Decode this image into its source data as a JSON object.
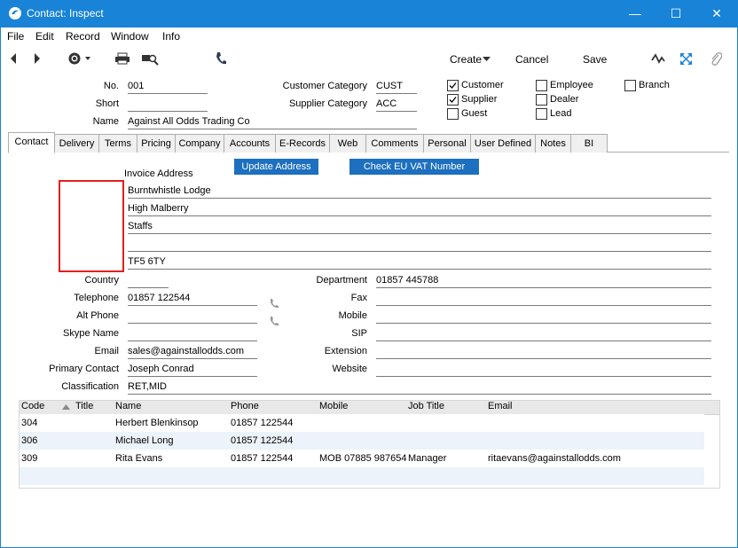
{
  "window": {
    "title": "Contact: Inspect"
  },
  "menus": [
    "File",
    "Edit",
    "Record",
    "Window",
    "Info"
  ],
  "toolbar": {
    "create": "Create",
    "cancel": "Cancel",
    "save": "Save"
  },
  "header": {
    "no_label": "No.",
    "no_value": "001",
    "short_label": "Short",
    "short_value": "",
    "name_label": "Name",
    "name_value": "Against All Odds Trading Co",
    "customer_category_label": "Customer Category",
    "customer_category_value": "CUST",
    "supplier_category_label": "Supplier Category",
    "supplier_category_value": "ACC"
  },
  "checkboxes": [
    {
      "label": "Customer",
      "checked": true
    },
    {
      "label": "Supplier",
      "checked": true
    },
    {
      "label": "Guest",
      "checked": false
    },
    {
      "label": "Employee",
      "checked": false
    },
    {
      "label": "Dealer",
      "checked": false
    },
    {
      "label": "Lead",
      "checked": false
    },
    {
      "label": "Branch",
      "checked": false
    }
  ],
  "tabs": [
    "Contact",
    "Delivery",
    "Terms",
    "Pricing",
    "Company",
    "Accounts",
    "E-Records",
    "Web",
    "Comments",
    "Personal",
    "User Defined",
    "Notes",
    "BI"
  ],
  "buttons": {
    "update_address": "Update Address",
    "check_vat": "Check EU VAT Number"
  },
  "address": {
    "label": "Invoice Address",
    "lines": [
      "Burntwhistle Lodge",
      "High Malberry",
      "Staffs",
      "",
      "TF5 6TY"
    ]
  },
  "fields_left": [
    {
      "label": "Country",
      "value": ""
    },
    {
      "label": "Telephone",
      "value": "01857 122544"
    },
    {
      "label": "Alt Phone",
      "value": ""
    },
    {
      "label": "Skype Name",
      "value": ""
    },
    {
      "label": "Email",
      "value": "sales@againstallodds.com"
    },
    {
      "label": "Primary Contact",
      "value": "Joseph Conrad"
    },
    {
      "label": "Classification",
      "value": "RET,MID"
    }
  ],
  "fields_right": [
    {
      "label": "Department",
      "value": "01857 445788"
    },
    {
      "label": "Fax",
      "value": ""
    },
    {
      "label": "Mobile",
      "value": ""
    },
    {
      "label": "SIP",
      "value": ""
    },
    {
      "label": "Extension",
      "value": ""
    },
    {
      "label": "Website",
      "value": ""
    }
  ],
  "grid": {
    "columns": [
      "Code",
      "Title",
      "Name",
      "Phone",
      "Mobile",
      "Job Title",
      "Email"
    ],
    "rows": [
      [
        "304",
        "",
        "Herbert Blenkinsop",
        "01857 122544",
        "",
        "",
        ""
      ],
      [
        "306",
        "",
        "Michael Long",
        "01857 122544",
        "",
        "",
        ""
      ],
      [
        "309",
        "",
        "Rita Evans",
        "01857 122544",
        "MOB 07885 987654",
        "Manager",
        "ritaevans@againstallodds.com"
      ]
    ]
  },
  "colors": {
    "titlebar": "#1883d7",
    "button": "#1d6fbf",
    "highlight_box": "#e0201f"
  }
}
